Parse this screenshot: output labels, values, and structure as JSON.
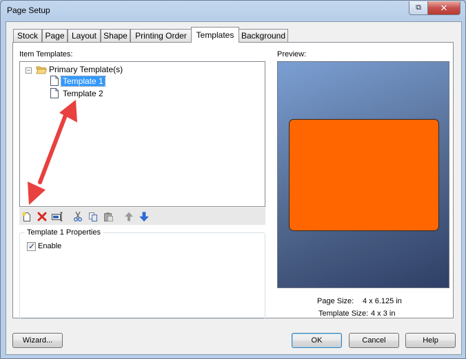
{
  "window": {
    "title": "Page Setup",
    "restore_glyph": "⧉",
    "close_glyph": "✕"
  },
  "tabs": [
    {
      "label": "Stock",
      "active": false
    },
    {
      "label": "Page",
      "active": false
    },
    {
      "label": "Layout",
      "active": false
    },
    {
      "label": "Shape",
      "active": false
    },
    {
      "label": "Printing Order",
      "active": false
    },
    {
      "label": "Templates",
      "active": true
    },
    {
      "label": "Background",
      "active": false
    }
  ],
  "item_templates": {
    "label": "Item Templates:",
    "tree": {
      "root": {
        "label": "Primary Template(s)",
        "expanded_glyph": "−"
      },
      "children": [
        {
          "label": "Template 1",
          "selected": true
        },
        {
          "label": "Template 2",
          "selected": false
        }
      ]
    }
  },
  "toolbar": {
    "icons": [
      "new-template-icon",
      "delete-icon",
      "rename-icon",
      "cut-icon",
      "copy-icon",
      "paste-icon",
      "move-up-icon",
      "move-down-icon"
    ]
  },
  "properties": {
    "title": "Template 1 Properties",
    "enable_label": "Enable",
    "enable_checked": true,
    "check_glyph": "✓"
  },
  "preview": {
    "label": "Preview:",
    "page_size_label": "Page Size:",
    "page_size_value": "4 x 6.125 in",
    "template_size_label": "Template Size:",
    "template_size_value": "4 x 3 in",
    "template_color": "#ff6600"
  },
  "buttons": {
    "wizard": "Wizard...",
    "ok": "OK",
    "cancel": "Cancel",
    "help": "Help"
  },
  "colors": {
    "selection": "#3399ff",
    "annotation_arrow": "#e8413f"
  }
}
